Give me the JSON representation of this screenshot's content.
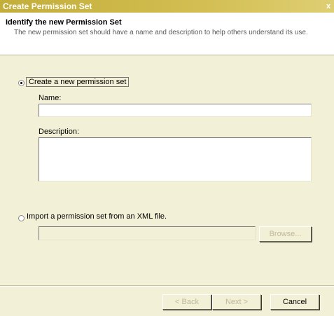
{
  "window": {
    "title": "Create Permission Set",
    "close_glyph": "x"
  },
  "header": {
    "title": "Identify the new Permission Set",
    "description": "The new permission set should have a name and description to help others understand its use."
  },
  "options": {
    "create_new": {
      "label": "Create a new permission set",
      "selected": true
    },
    "import_xml": {
      "label": "Import a permission set from an XML file.",
      "selected": false
    }
  },
  "fields": {
    "name": {
      "label": "Name:",
      "value": ""
    },
    "description": {
      "label": "Description:",
      "value": ""
    },
    "import_path": {
      "value": ""
    }
  },
  "buttons": {
    "browse": "Browse...",
    "back": "< Back",
    "next": "Next >",
    "cancel": "Cancel"
  },
  "colors": {
    "title_bar": "#c3ae3a",
    "face": "#f2f0d6",
    "disabled_text": "#bdb89a"
  }
}
